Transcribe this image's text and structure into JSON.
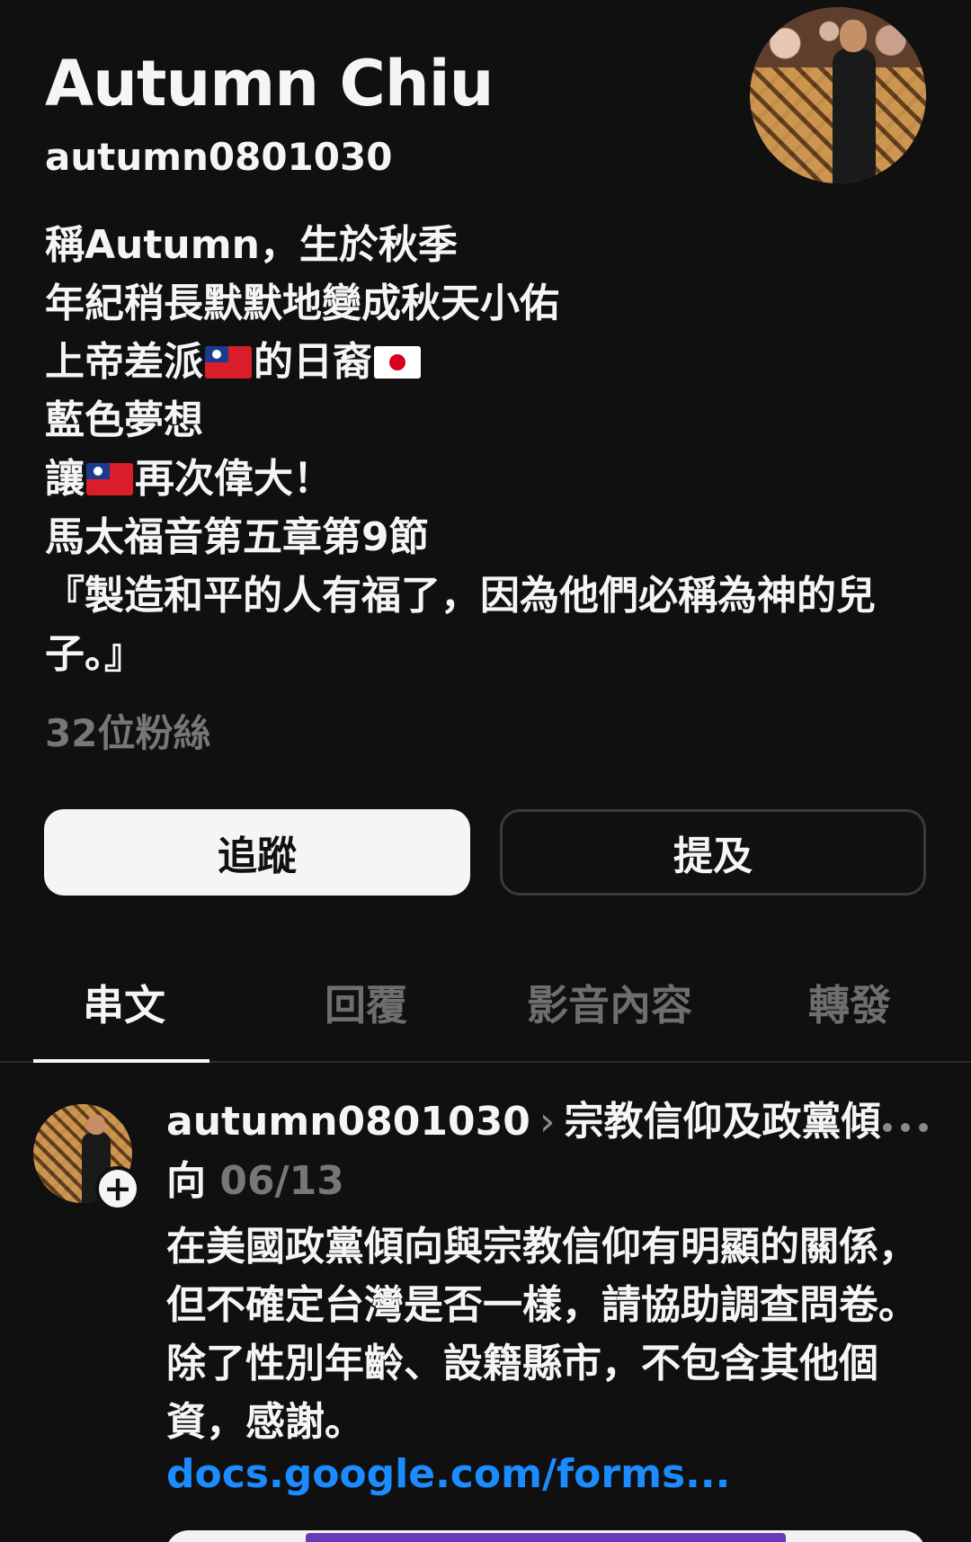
{
  "profile": {
    "name": "Autumn Chiu",
    "handle": "autumn0801030",
    "bio_lines": [
      "稱Autumn，生於秋季",
      "年紀稍長默默地變成秋天小佑",
      "上帝差派",
      "的日裔",
      "藍色夢想",
      "讓",
      "再次偉大！",
      "馬太福音第五章第9節",
      "『製造和平的人有福了，因為他們必稱為神的兒子。』"
    ],
    "followers": "32位粉絲"
  },
  "buttons": {
    "follow": "追蹤",
    "mention": "提及"
  },
  "tabs": [
    {
      "label": "串文",
      "active": true
    },
    {
      "label": "回覆",
      "active": false
    },
    {
      "label": "影音內容",
      "active": false
    },
    {
      "label": "轉發",
      "active": false
    }
  ],
  "post": {
    "author": "autumn0801030",
    "topic": "宗教信仰及政黨傾向",
    "date": "06/13",
    "body": "在美國政黨傾向與宗教信仰有明顯的關係，但不確定台灣是否一樣，請協助調查問卷。除了性別年齡、設籍縣市，不包含其他個資，感謝。",
    "link": "docs.google.com/forms..."
  },
  "colors": {
    "background": "#101010",
    "text": "#f3f5f7",
    "muted": "#777777",
    "link": "#1a8cff",
    "form_accent": "#673ab7"
  },
  "icons": [
    "flag-taiwan-icon",
    "flag-japan-icon",
    "chevron-right-icon",
    "more-icon",
    "plus-icon"
  ]
}
